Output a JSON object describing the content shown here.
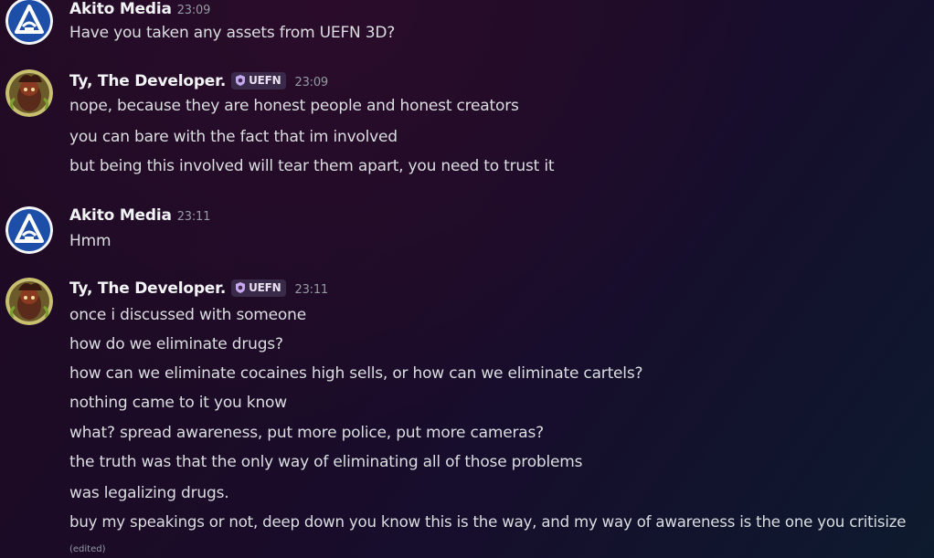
{
  "messages": [
    {
      "author": "Akito Media",
      "time": "23:09",
      "avatar": "akito-logo",
      "lines": [
        "Have you taken any assets from UEFN 3D?"
      ]
    },
    {
      "author": "Ty, The Developer.",
      "time": "23:09",
      "tag": "UEFN",
      "avatar": "ty-character",
      "lines": [
        "nope, because they are honest people and honest creators",
        "you can bare with the fact that im involved",
        "but being this involved will tear them apart, you need to trust it"
      ]
    },
    {
      "author": "Akito Media",
      "time": "23:11",
      "avatar": "akito-logo",
      "lines": [
        "Hmm"
      ]
    },
    {
      "author": "Ty, The Developer.",
      "time": "23:11",
      "tag": "UEFN",
      "avatar": "ty-character",
      "lines": [
        "once i discussed with someone",
        "how do we eliminate drugs?",
        "how can we eliminate cocaines high sells, or how can we eliminate cartels?",
        "nothing came to it you know",
        "what? spread awareness, put more police, put more cameras?",
        "the truth was that the only way of eliminating all of those problems",
        "was legalizing drugs.",
        "buy my speakings or not, deep down you know this is the way, and my way of awareness is the one you critisize"
      ],
      "edited": "(edited)"
    }
  ],
  "colors": {
    "author": "#f2f3f5",
    "text": "#dbdee1",
    "timestamp": "#949ba4",
    "akito_blue": "#1e4fa8",
    "tag_bg": "#3a2a4a"
  }
}
